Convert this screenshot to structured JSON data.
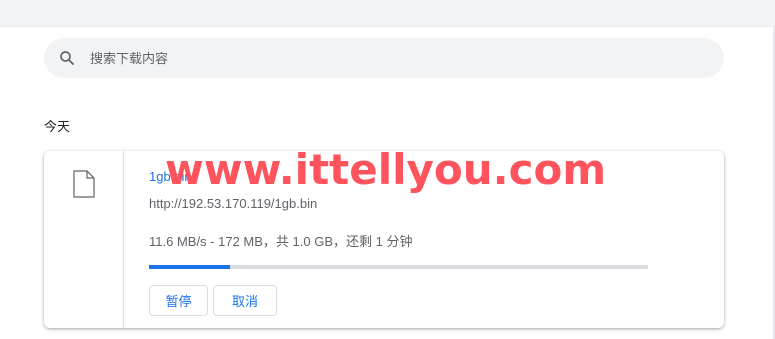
{
  "search": {
    "placeholder": "搜索下载内容",
    "icon": "search-icon"
  },
  "section": {
    "title": "今天"
  },
  "download": {
    "file_name": "1gb.bin",
    "url": "http://192.53.170.119/1gb.bin",
    "status_text": "11.6 MB/s - 172 MB，共 1.0 GB，还剩 1 分钟",
    "progress_fraction": 0.162,
    "icon": "file-icon",
    "pause_label": "暂停",
    "cancel_label": "取消"
  },
  "watermark": {
    "text": "www.ittellyou.com",
    "color": "#ff4b55"
  },
  "colors": {
    "accent": "#1a73e8",
    "background": "#ffffff",
    "search_bg": "#f1f3f4"
  }
}
